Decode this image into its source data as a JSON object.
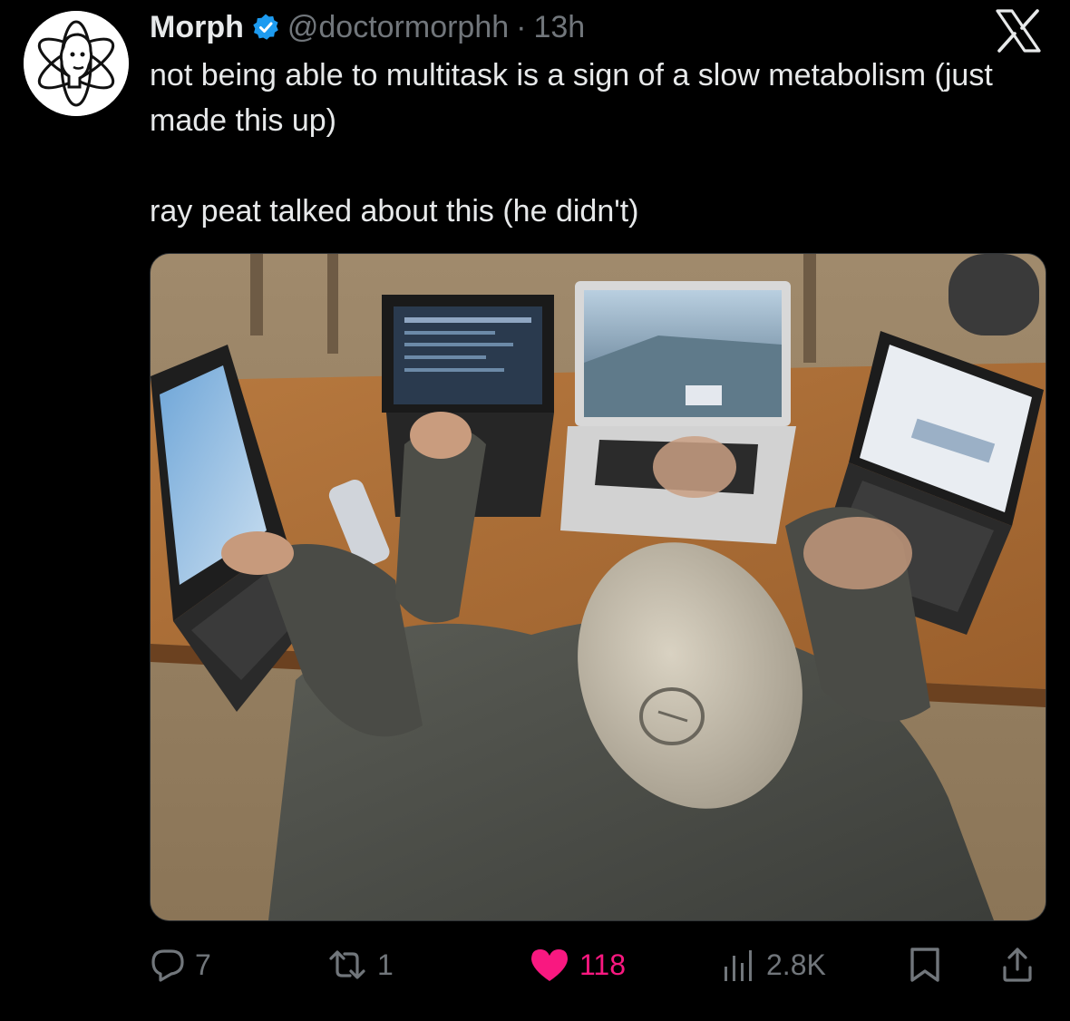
{
  "tweet": {
    "author_name": "Morph",
    "author_handle": "@doctormorphh",
    "separator": "·",
    "time": "13h",
    "text_line_1": "not being able to multitask is a sign of a slow metabolism (just made this up)",
    "text_line_2": "ray peat talked about this (he didn't)"
  },
  "icons": {
    "avatar": "atom-head-avatar",
    "verified": "verified-badge-icon",
    "brand": "x-logo-icon",
    "reply": "reply-icon",
    "retweet": "retweet-icon",
    "like": "heart-icon",
    "views": "views-icon",
    "bookmark": "bookmark-icon",
    "share": "share-icon"
  },
  "actions": {
    "replies": "7",
    "retweets": "1",
    "likes": "118",
    "views": "2.8K"
  },
  "colors": {
    "background": "#000000",
    "text": "#e7e9ea",
    "secondary_text": "#71767b",
    "verified_blue": "#1d9bf0",
    "like_pink": "#f91880"
  }
}
